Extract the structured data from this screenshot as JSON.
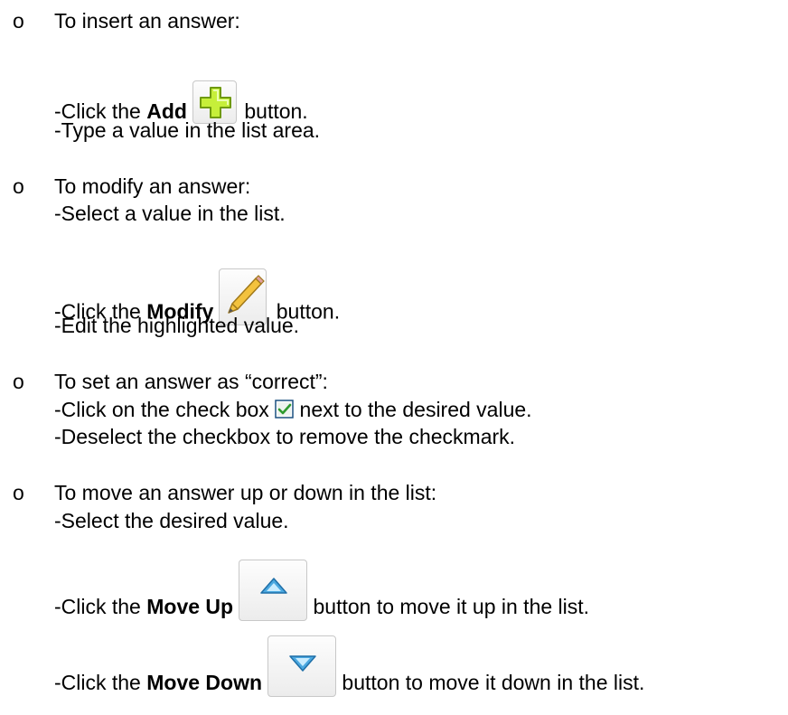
{
  "items": [
    {
      "bullet": "o",
      "heading": "To insert an answer:",
      "steps": {
        "click_prefix": "-Click the ",
        "click_bold": "Add",
        "click_suffix": " button.",
        "type_value": "-Type a value in the list area."
      },
      "icon": "plus-icon"
    },
    {
      "bullet": "o",
      "heading": "To modify an answer:",
      "steps": {
        "select": "-Select a value in the list.",
        "click_prefix": "-Click the ",
        "click_bold": "Modify",
        "click_suffix": " button.",
        "edit": "-Edit the highlighted value."
      },
      "icon": "pencil-icon"
    },
    {
      "bullet": "o",
      "heading": "To set an answer as “correct”:",
      "steps": {
        "click_prefix": "-Click on the check box ",
        "click_suffix": " next to the desired value.",
        "deselect": "-Deselect the checkbox to remove the checkmark."
      },
      "icon": "checkbox-checked-icon"
    },
    {
      "bullet": "o",
      "heading": "To move an answer up or down in the list:",
      "steps": {
        "select": "-Select the desired value.",
        "up_prefix": "-Click the ",
        "up_bold": "Move Up",
        "up_suffix": " button to move it up in the list.",
        "down_prefix": "-Click the ",
        "down_bold": "Move Down",
        "down_suffix": " button to move it down in the list."
      },
      "icons": [
        "triangle-up-icon",
        "triangle-down-icon"
      ]
    }
  ],
  "colors": {
    "plus_fill": "#c6ef3a",
    "plus_stroke": "#6f9a10",
    "pencil_body": "#f3c23e",
    "triangle_blue": "#4aa8e0",
    "checkbox_green": "#2e9a2e"
  }
}
